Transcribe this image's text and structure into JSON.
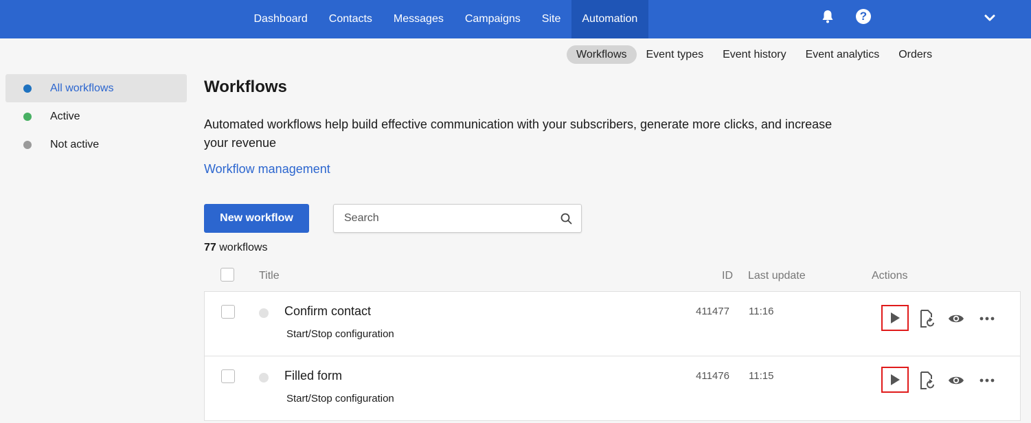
{
  "topnav": {
    "items": [
      "Dashboard",
      "Contacts",
      "Messages",
      "Campaigns",
      "Site",
      "Automation"
    ],
    "active_index": 5
  },
  "icons": {
    "bell": "bell-icon",
    "help": "question-circle-icon",
    "help_glyph": "?",
    "chevron": "chevron-down-icon",
    "search": "search-icon"
  },
  "subnav": {
    "items": [
      "Workflows",
      "Event types",
      "Event history",
      "Event analytics",
      "Orders"
    ],
    "active_index": 0
  },
  "sidebar": {
    "items": [
      {
        "label": "All workflows",
        "dot_color": "#1e72bf"
      },
      {
        "label": "Active",
        "dot_color": "#48b063"
      },
      {
        "label": "Not active",
        "dot_color": "#9a9a9a"
      }
    ]
  },
  "page": {
    "title": "Workflows",
    "description": "Automated workflows help build effective communication with your subscribers, generate more clicks, and increase your revenue",
    "management_link": "Workflow management",
    "new_button": "New workflow",
    "search_placeholder": "Search",
    "count_number": "77",
    "count_label": "workflows"
  },
  "table": {
    "headers": {
      "title": "Title",
      "id": "ID",
      "last_update": "Last update",
      "actions": "Actions"
    },
    "rows": [
      {
        "name": "Confirm contact",
        "subtitle": "Start/Stop configuration",
        "id": "411477",
        "last_update": "11:16"
      },
      {
        "name": "Filled form",
        "subtitle": "Start/Stop configuration",
        "id": "411476",
        "last_update": "11:15"
      }
    ]
  },
  "colors": {
    "brand": "#2c66cf",
    "highlight": "#e01b1b"
  }
}
